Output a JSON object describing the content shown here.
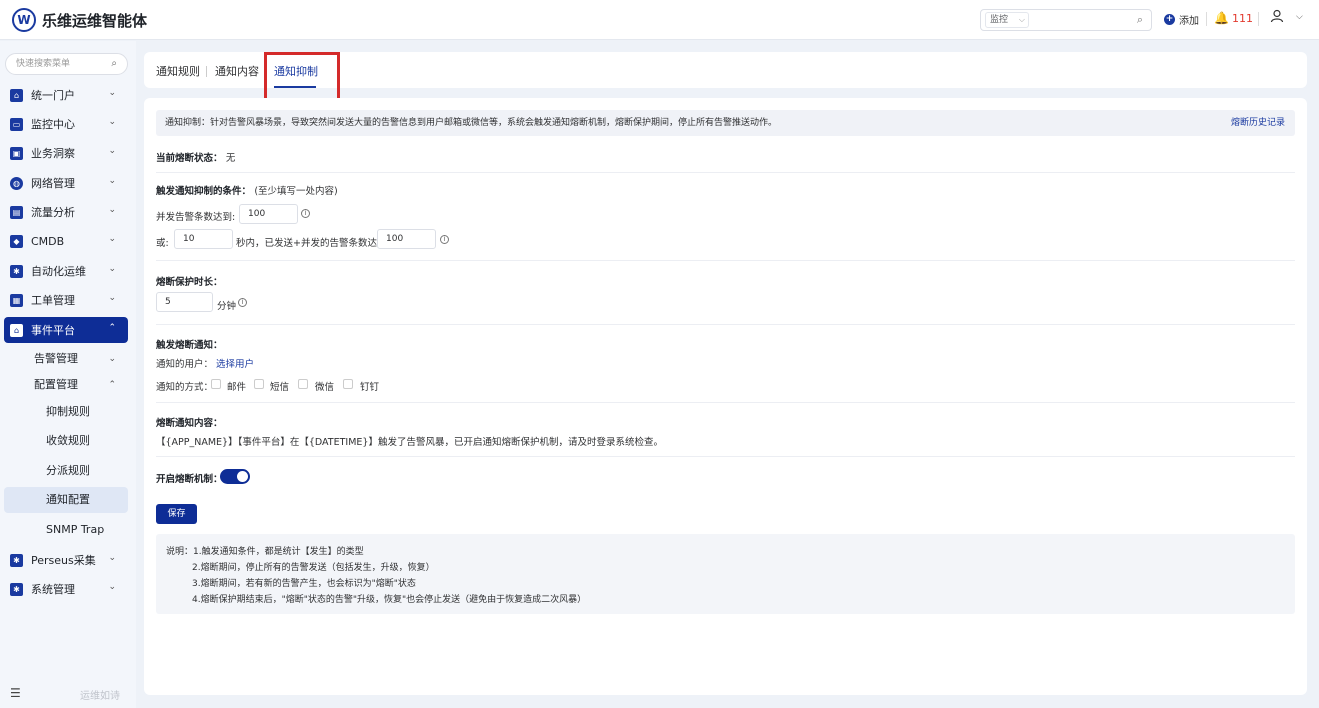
{
  "header": {
    "logo_letter": "W",
    "title": "乐维运维智能体",
    "search_scope": "监控",
    "add_label": "添加",
    "alert_count": "111"
  },
  "sidebar": {
    "search_placeholder": "快速搜索菜单",
    "items": [
      {
        "label": "统一门户",
        "icon": "home-icon"
      },
      {
        "label": "监控中心",
        "icon": "monitor-icon"
      },
      {
        "label": "业务洞察",
        "icon": "insight-icon"
      },
      {
        "label": "网络管理",
        "icon": "globe-icon"
      },
      {
        "label": "流量分析",
        "icon": "chart-icon"
      },
      {
        "label": "CMDB",
        "icon": "cube-icon"
      },
      {
        "label": "自动化运维",
        "icon": "gear-icon"
      },
      {
        "label": "工单管理",
        "icon": "ticket-icon"
      },
      {
        "label": "事件平台",
        "icon": "bell-icon"
      }
    ],
    "sub_items": [
      {
        "label": "告警管理"
      },
      {
        "label": "配置管理"
      }
    ],
    "config_items": [
      {
        "label": "抑制规则"
      },
      {
        "label": "收敛规则"
      },
      {
        "label": "分派规则"
      },
      {
        "label": "通知配置"
      },
      {
        "label": "SNMP Trap"
      }
    ],
    "tail_items": [
      {
        "label": "Perseus采集",
        "icon": "gear-icon"
      },
      {
        "label": "系统管理",
        "icon": "settings-icon"
      }
    ],
    "bottom_text": "运维如诗"
  },
  "tabs": [
    {
      "label": "通知规则"
    },
    {
      "label": "通知内容"
    },
    {
      "label": "通知抑制"
    }
  ],
  "main": {
    "info_text": "通知抑制：针对告警风暴场景，导致突然间发送大量的告警信息到用户邮箱或微信等，系统会触发通知熔断机制，熔断保护期间，停止所有告警推送动作。",
    "history_link": "熔断历史记录",
    "current_status_label": "当前熔断状态：",
    "current_status_value": "无",
    "trigger_label": "触发通知抑制的条件：",
    "trigger_hint": "(至少填写一处内容)",
    "concurrent_label": "并发告警条数达到:",
    "concurrent_value": "100",
    "or_label": "或:",
    "seconds_value": "10",
    "seconds_text": "秒内，已发送+并发的告警条数达到",
    "sent_value": "100",
    "protect_label": "熔断保护时长：",
    "protect_value": "5",
    "minutes_text": "分钟",
    "notify_label": "触发熔断通知：",
    "notify_users_label": "通知的用户：",
    "select_users": "选择用户",
    "notify_methods_label": "通知的方式：",
    "methods": [
      "邮件",
      "短信",
      "微信",
      "钉钉"
    ],
    "content_label": "熔断通知内容：",
    "content_text": "【{APP_NAME}】【事件平台】在【{DATETIME}】触发了告警风暴，已开启通知熔断保护机制，请及时登录系统检查。",
    "enable_label": "开启熔断机制：",
    "save_label": "保存",
    "notes": [
      "说明：1.触发通知条件，都是统计【发生】的类型",
      "2.熔断期间，停止所有的告警发送（包括发生，升级，恢复）",
      "3.熔断期间，若有新的告警产生，也会标识为\"熔断\"状态",
      "4.熔断保护期结束后，\"熔断\"状态的告警\"升级，恢复\"也会停止发送（避免由于恢复造成二次风暴）"
    ]
  }
}
